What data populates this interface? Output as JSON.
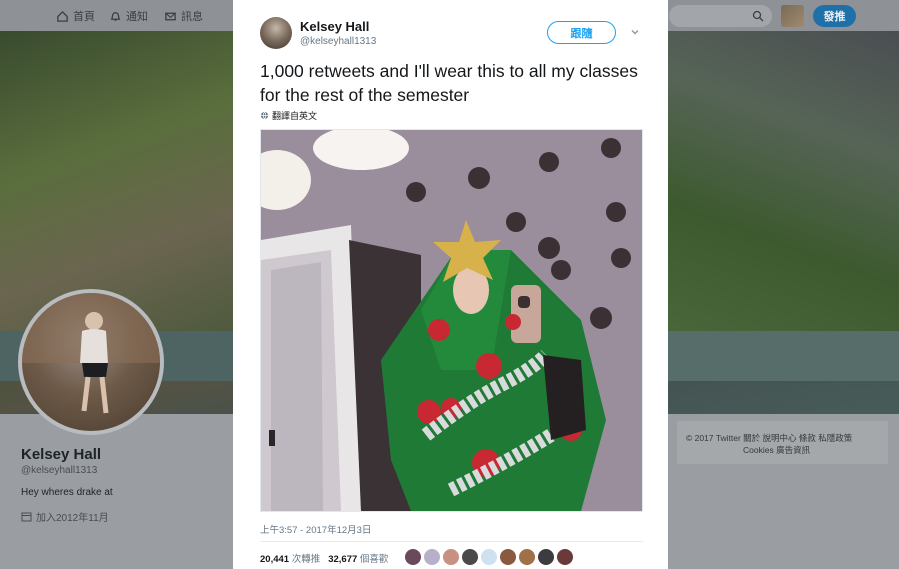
{
  "nav": {
    "home": "首頁",
    "notifications": "通知",
    "messages": "訊息",
    "tweet_button": "發推"
  },
  "profile": {
    "name": "Kelsey Hall",
    "handle": "@kelseyhall1313",
    "bio": "Hey wheres drake at",
    "joined": "加入2012年11月"
  },
  "footer": {
    "line1": "© 2017 Twitter   關於   說明中心   條款   私隱政策",
    "line2": "Cookies   廣告資訊"
  },
  "tweet": {
    "author_name": "Kelsey Hall",
    "author_handle": "@kelseyhall1313",
    "follow_label": "跟隨",
    "text": "1,000 retweets and I'll wear this to all my classes for the rest of the semester",
    "translate_label": "翻譯自英文",
    "timestamp": "上午3:57 - 2017年12月3日",
    "retweets_count": "20,441",
    "retweets_label": "次轉推",
    "likes_count": "32,677",
    "likes_label": "個喜歡"
  },
  "liker_colors": [
    "#6a4a5a",
    "#b8b0c8",
    "#c89080",
    "#4a4a4a",
    "#cfe0ef",
    "#8a5a40",
    "#a07048",
    "#3c3c40",
    "#6a3a3a"
  ]
}
